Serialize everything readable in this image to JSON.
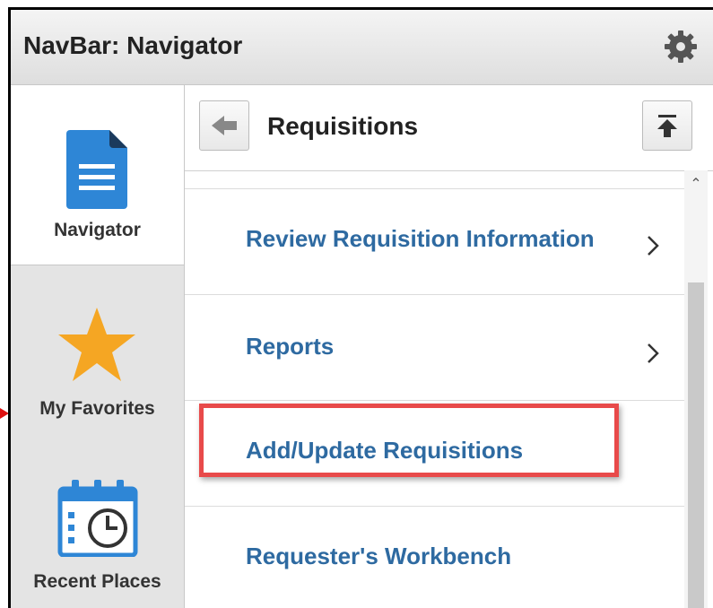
{
  "header": {
    "title": "NavBar: Navigator",
    "settings_icon": "gear-icon"
  },
  "sidebar": {
    "items": [
      {
        "label": "Navigator",
        "icon": "document-icon",
        "active": true
      },
      {
        "label": "My Favorites",
        "icon": "star-icon",
        "active": false
      },
      {
        "label": "Recent Places",
        "icon": "calendar-clock-icon",
        "active": false
      }
    ]
  },
  "panel": {
    "title": "Requisitions",
    "back_icon": "back-arrow-icon",
    "top_icon": "scroll-to-top-icon",
    "items": [
      {
        "label": "Review Requisition Information",
        "has_children": true
      },
      {
        "label": "Reports",
        "has_children": true
      },
      {
        "label": "Add/Update Requisitions",
        "has_children": false,
        "highlighted": true
      },
      {
        "label": "Requester's Workbench",
        "has_children": false
      }
    ]
  },
  "colors": {
    "link": "#2e6aa1",
    "highlight": "#e84a4a",
    "icon_blue": "#2e86d6",
    "star": "#f5a623"
  }
}
